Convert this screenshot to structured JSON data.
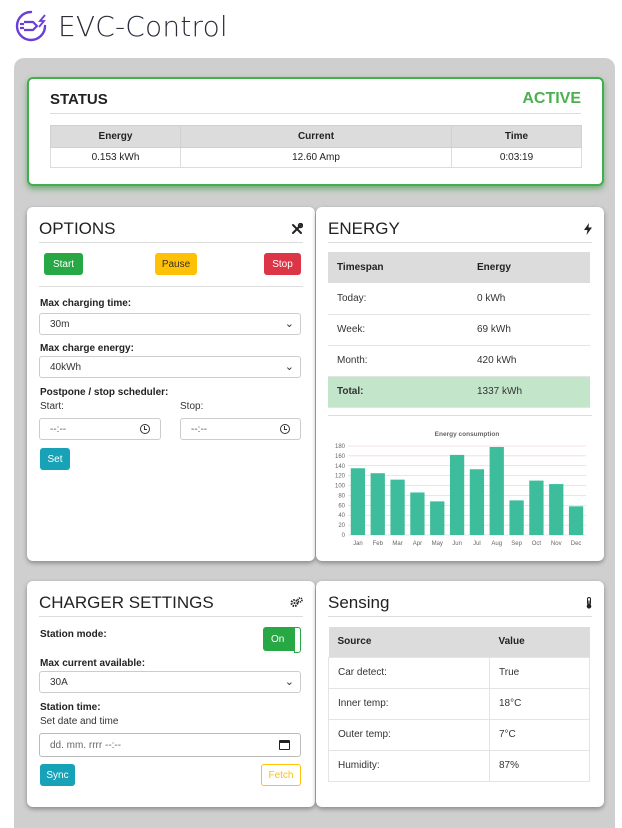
{
  "app": {
    "title": "EVC-Control"
  },
  "status": {
    "title": "STATUS",
    "state": "ACTIVE",
    "headers": [
      "Energy",
      "Current",
      "Time"
    ],
    "values": [
      "0.153 kWh",
      "12.60 Amp",
      "0:03:19"
    ]
  },
  "options": {
    "title": "OPTIONS",
    "icon": "tools-icon",
    "start_label": "Start",
    "pause_label": "Pause",
    "stop_label": "Stop",
    "max_time_label": "Max charging time:",
    "max_time_value": "30m",
    "max_energy_label": "Max charge energy:",
    "max_energy_value": "40kWh",
    "scheduler_label": "Postpone / stop scheduler:",
    "start_sub": "Start:",
    "stop_sub": "Stop:",
    "start_time_placeholder": "--:--",
    "stop_time_placeholder": "--:--",
    "set_label": "Set"
  },
  "energy": {
    "title": "ENERGY",
    "icon": "bolt-icon",
    "headers": [
      "Timespan",
      "Energy"
    ],
    "rows": [
      {
        "span": "Today:",
        "value": "0 kWh"
      },
      {
        "span": "Week:",
        "value": "69 kWh"
      },
      {
        "span": "Month:",
        "value": "420 kWh"
      },
      {
        "span": "Total:",
        "value": "1337 kWh"
      }
    ]
  },
  "chart_data": {
    "type": "bar",
    "title": "Energy consumption",
    "categories": [
      "Jan",
      "Feb",
      "Mar",
      "Apr",
      "May",
      "Jun",
      "Jul",
      "Aug",
      "Sep",
      "Oct",
      "Nov",
      "Dec"
    ],
    "values": [
      135,
      125,
      112,
      86,
      68,
      162,
      133,
      178,
      70,
      110,
      103,
      58
    ],
    "ylim": [
      0,
      180
    ],
    "yticks": [
      0,
      20,
      40,
      60,
      80,
      100,
      120,
      140,
      160,
      180
    ],
    "color": "#3dbd9b",
    "grid": true
  },
  "charger": {
    "title": "CHARGER SETTINGS",
    "icon": "gears-icon",
    "mode_label": "Station mode:",
    "mode_toggle": "On",
    "max_current_label": "Max current available:",
    "max_current_value": "30A",
    "station_time_label": "Station time:",
    "station_time_sub": "Set date and time",
    "datetime_placeholder": "dd. mm. rrrr --:--",
    "sync_label": "Sync",
    "fetch_label": "Fetch"
  },
  "sensing": {
    "title": "Sensing",
    "icon": "thermometer-icon",
    "headers": [
      "Source",
      "Value"
    ],
    "rows": [
      {
        "source": "Car detect:",
        "value": "True"
      },
      {
        "source": "Inner temp:",
        "value": "18°C"
      },
      {
        "source": "Outer temp:",
        "value": "7°C"
      },
      {
        "source": "Humidity:",
        "value": "87%"
      }
    ]
  },
  "colors": {
    "accent_green": "#28a745",
    "active_green": "#4caf50",
    "warning": "#ffc107",
    "danger": "#dc3545",
    "info": "#17a2b8",
    "bar": "#3dbd9b"
  }
}
